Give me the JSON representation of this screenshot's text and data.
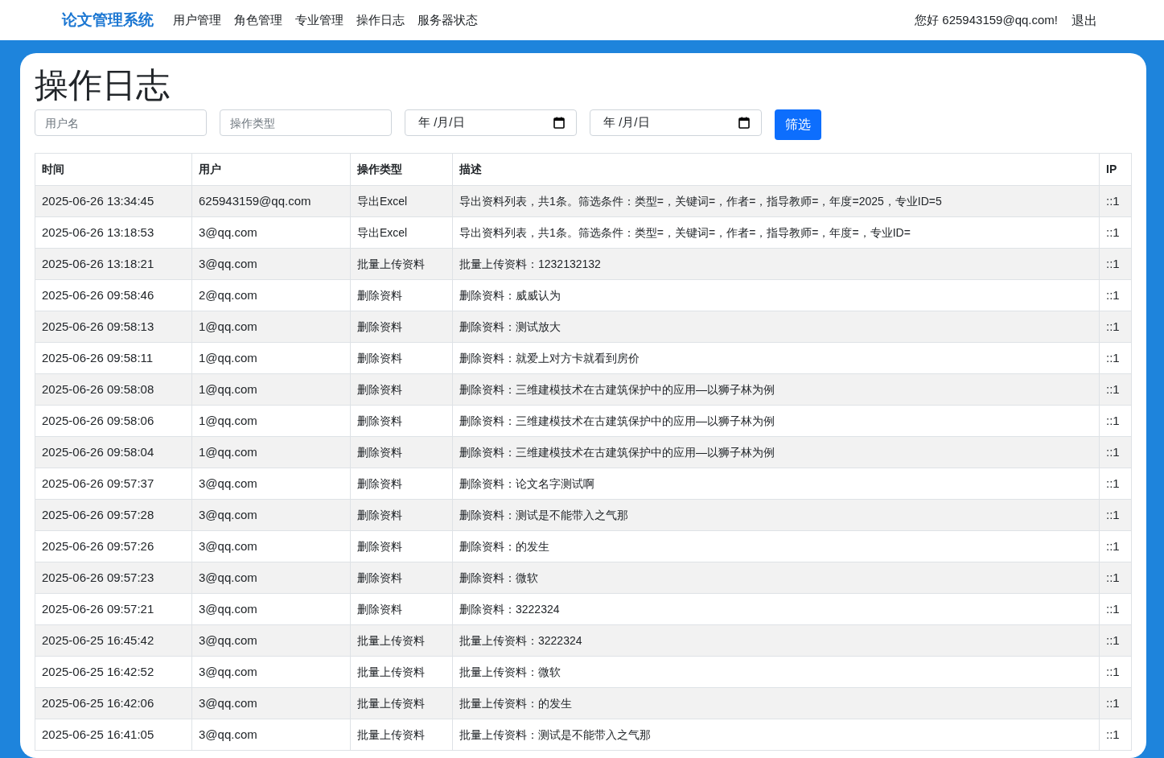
{
  "navbar": {
    "brand": "论文管理系统",
    "links": [
      {
        "label": "用户管理"
      },
      {
        "label": "角色管理"
      },
      {
        "label": "专业管理"
      },
      {
        "label": "操作日志"
      },
      {
        "label": "服务器状态"
      }
    ],
    "greeting": "您好 625943159@qq.com!",
    "logout": "退出"
  },
  "page": {
    "title": "操作日志"
  },
  "filters": {
    "username": {
      "placeholder": "用户名"
    },
    "action_type": {
      "placeholder": "操作类型"
    },
    "start_date": {
      "value": "年 /月/日"
    },
    "end_date": {
      "value": "年 /月/日"
    },
    "button": "筛选"
  },
  "table": {
    "columns": [
      "时间",
      "用户",
      "操作类型",
      "描述",
      "IP"
    ],
    "rows": [
      [
        "2025-06-26 13:34:45",
        "625943159@qq.com",
        "导出Excel",
        "导出资料列表，共1条。筛选条件：类型=，关键词=，作者=，指导教师=，年度=2025，专业ID=5",
        "::1"
      ],
      [
        "2025-06-26 13:18:53",
        "3@qq.com",
        "导出Excel",
        "导出资料列表，共1条。筛选条件：类型=，关键词=，作者=，指导教师=，年度=，专业ID=",
        "::1"
      ],
      [
        "2025-06-26 13:18:21",
        "3@qq.com",
        "批量上传资料",
        "批量上传资料：1232132132",
        "::1"
      ],
      [
        "2025-06-26 09:58:46",
        "2@qq.com",
        "删除资料",
        "删除资料：威威认为",
        "::1"
      ],
      [
        "2025-06-26 09:58:13",
        "1@qq.com",
        "删除资料",
        "删除资料：测试放大",
        "::1"
      ],
      [
        "2025-06-26 09:58:11",
        "1@qq.com",
        "删除资料",
        "删除资料：就爱上对方卡就看到房价",
        "::1"
      ],
      [
        "2025-06-26 09:58:08",
        "1@qq.com",
        "删除资料",
        "删除资料：三维建模技术在古建筑保护中的应用—以狮子林为例",
        "::1"
      ],
      [
        "2025-06-26 09:58:06",
        "1@qq.com",
        "删除资料",
        "删除资料：三维建模技术在古建筑保护中的应用—以狮子林为例",
        "::1"
      ],
      [
        "2025-06-26 09:58:04",
        "1@qq.com",
        "删除资料",
        "删除资料：三维建模技术在古建筑保护中的应用—以狮子林为例",
        "::1"
      ],
      [
        "2025-06-26 09:57:37",
        "3@qq.com",
        "删除资料",
        "删除资料：论文名字测试啊",
        "::1"
      ],
      [
        "2025-06-26 09:57:28",
        "3@qq.com",
        "删除资料",
        "删除资料：测试是不能带入之气那",
        "::1"
      ],
      [
        "2025-06-26 09:57:26",
        "3@qq.com",
        "删除资料",
        "删除资料：的发生",
        "::1"
      ],
      [
        "2025-06-26 09:57:23",
        "3@qq.com",
        "删除资料",
        "删除资料：微软",
        "::1"
      ],
      [
        "2025-06-26 09:57:21",
        "3@qq.com",
        "删除资料",
        "删除资料：3222324",
        "::1"
      ],
      [
        "2025-06-25 16:45:42",
        "3@qq.com",
        "批量上传资料",
        "批量上传资料：3222324",
        "::1"
      ],
      [
        "2025-06-25 16:42:52",
        "3@qq.com",
        "批量上传资料",
        "批量上传资料：微软",
        "::1"
      ],
      [
        "2025-06-25 16:42:06",
        "3@qq.com",
        "批量上传资料",
        "批量上传资料：的发生",
        "::1"
      ],
      [
        "2025-06-25 16:41:05",
        "3@qq.com",
        "批量上传资料",
        "批量上传资料：测试是不能带入之气那",
        "::1"
      ]
    ]
  }
}
